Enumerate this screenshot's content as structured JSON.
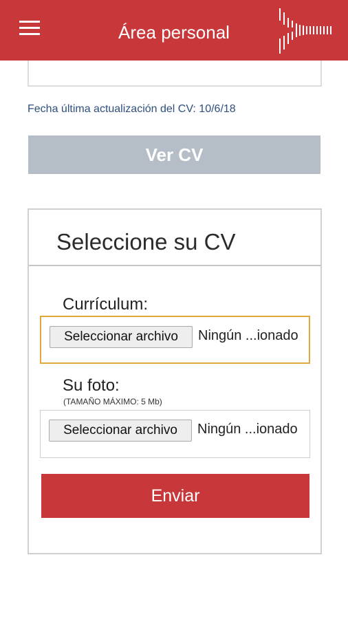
{
  "header": {
    "title": "Área personal",
    "menu_icon": "hamburger-menu-icon",
    "logo_icon": "brand-logo-icon",
    "color": "#c8383a"
  },
  "profile": {
    "last_update": "Fecha última actualización del CV: 10/6/18",
    "view_cv_label": "Ver CV"
  },
  "upload_form": {
    "title": "Seleccione su CV",
    "cv_field": {
      "label": "Currículum:",
      "button_label": "Seleccionar archivo",
      "status": "Ningún ...ionado"
    },
    "photo_field": {
      "label": "Su foto:",
      "note": "(TAMAÑO MÁXIMO: 5 Mb)",
      "button_label": "Seleccionar archivo",
      "status": "Ningún ...ionado"
    },
    "submit_label": "Enviar"
  }
}
